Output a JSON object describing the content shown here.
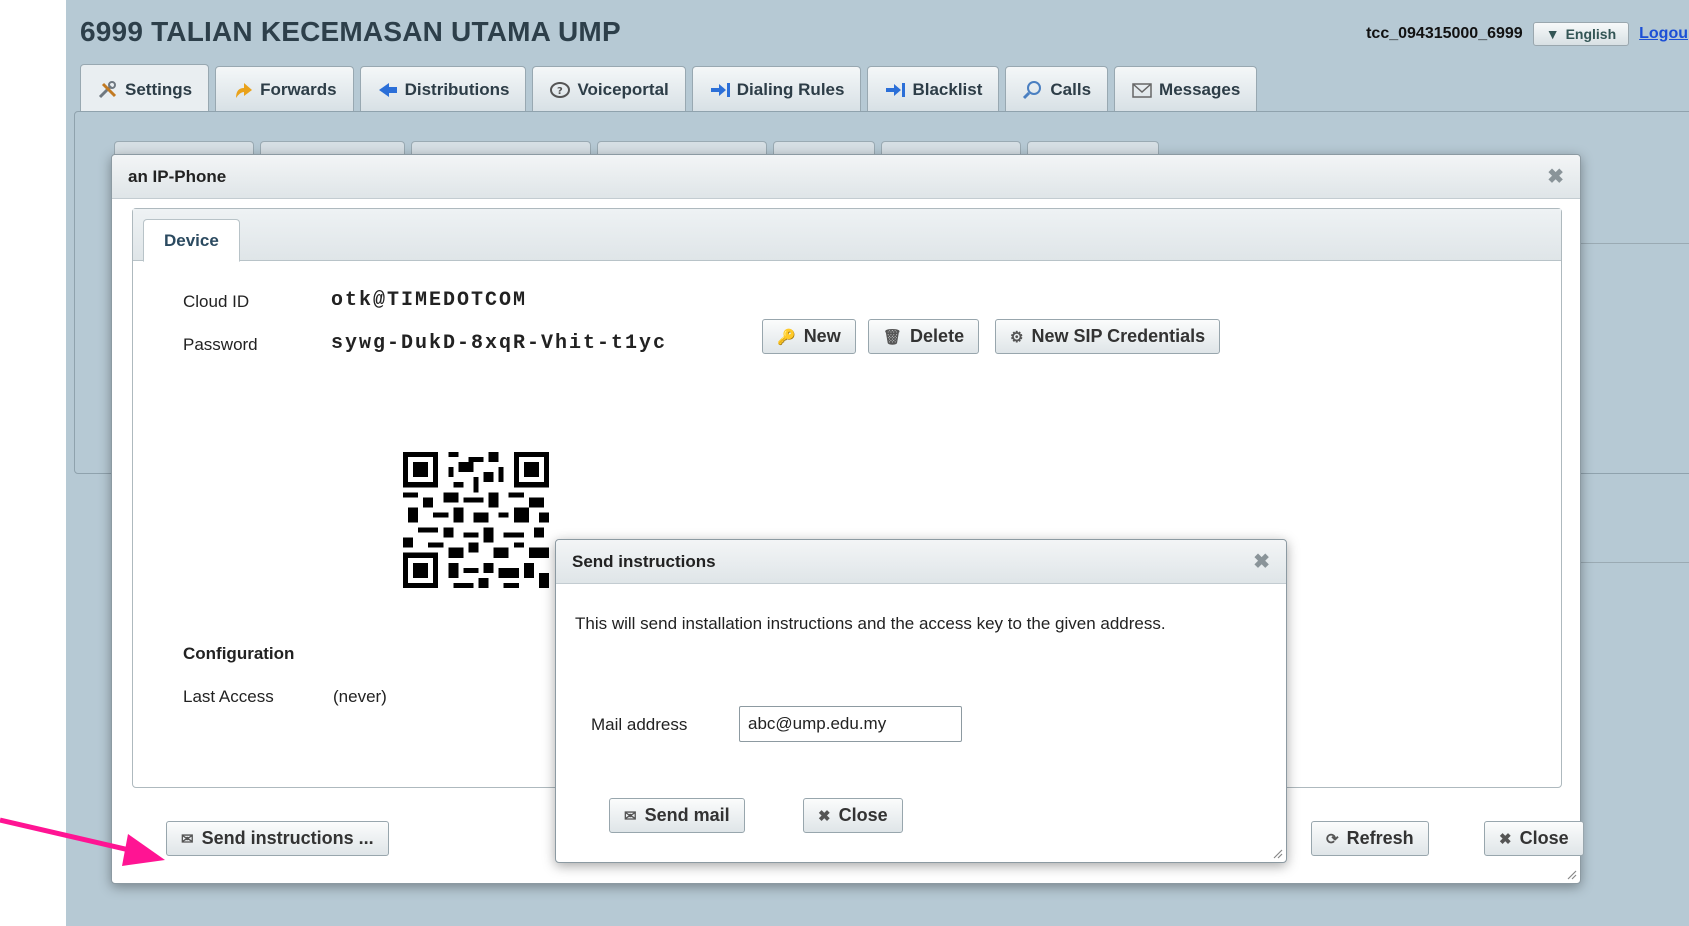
{
  "app": {
    "title": "6999 TALIAN KECEMASAN UTAMA UMP",
    "username": "tcc_094315000_6999",
    "language": "English",
    "logout": "Logou"
  },
  "tabs": [
    {
      "label": "Settings",
      "icon": "tools-icon"
    },
    {
      "label": "Forwards",
      "icon": "forward-arrow-icon"
    },
    {
      "label": "Distributions",
      "icon": "distribution-icon"
    },
    {
      "label": "Voiceportal",
      "icon": "voiceportal-icon"
    },
    {
      "label": "Dialing Rules",
      "icon": "dialing-rules-icon"
    },
    {
      "label": "Blacklist",
      "icon": "blacklist-icon"
    },
    {
      "label": "Calls",
      "icon": "calls-icon"
    },
    {
      "label": "Messages",
      "icon": "messages-icon"
    }
  ],
  "dialog": {
    "title": "an IP-Phone",
    "tab": "Device",
    "cloud_id_label": "Cloud ID",
    "cloud_id": "otk@TIMEDOTCOM",
    "password_label": "Password",
    "password": "sywg-DukD-8xqR-Vhit-t1yc",
    "new_btn": "New",
    "delete_btn": "Delete",
    "new_sip_btn": "New SIP Credentials",
    "configuration_heading": "Configuration",
    "last_access_label": "Last Access",
    "last_access_value": "(never)",
    "send_instructions_btn": "Send instructions ...",
    "refresh_btn": "Refresh",
    "close_btn": "Close"
  },
  "send_dialog": {
    "title": "Send instructions",
    "message": "This will send installation instructions and the access key to the given address.",
    "mail_label": "Mail address",
    "mail_value": "abc@ump.edu.my",
    "send_btn": "Send mail",
    "close_btn": "Close"
  },
  "colors": {
    "app_bg": "#b6c9d4",
    "title": "#2d3f4a",
    "arrow": "#ff1493"
  }
}
